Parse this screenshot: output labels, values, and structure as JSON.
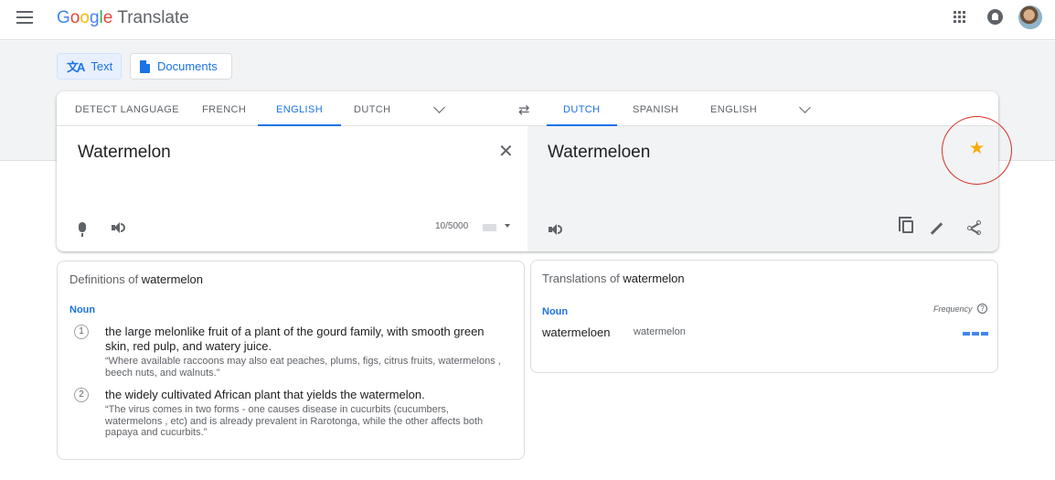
{
  "header": {
    "logo_letters": [
      "G",
      "o",
      "o",
      "g",
      "l",
      "e"
    ],
    "product": "Translate"
  },
  "modes": {
    "text": "Text",
    "documents": "Documents"
  },
  "source_langs": [
    "DETECT LANGUAGE",
    "FRENCH",
    "ENGLISH",
    "DUTCH"
  ],
  "target_langs": [
    "DUTCH",
    "SPANISH",
    "ENGLISH"
  ],
  "source": {
    "text": "Watermelon",
    "char_count": "10/5000"
  },
  "target": {
    "text": "Watermeloen"
  },
  "definitions": {
    "title_prefix": "Definitions of",
    "word": "watermelon",
    "pos": "Noun",
    "items": [
      {
        "num": "1",
        "text": "the large melonlike fruit of a plant of the gourd family, with smooth green skin, red pulp, and watery juice.",
        "example": "“Where available raccoons may also eat peaches, plums, figs, citrus fruits, watermelons , beech nuts, and walnuts.”"
      },
      {
        "num": "2",
        "text": "the widely cultivated African plant that yields the watermelon.",
        "example": "“The virus comes in two forms - one causes disease in cucurbits (cucumbers, watermelons , etc) and is already prevalent in Rarotonga, while the other affects both papaya and cucurbits.”"
      }
    ]
  },
  "translations": {
    "title_prefix": "Translations of",
    "word": "watermelon",
    "pos": "Noun",
    "frequency_label": "Frequency",
    "help_glyph": "?",
    "rows": [
      {
        "word": "watermeloen",
        "back": "watermelon",
        "frequency": 1.0
      }
    ]
  },
  "colors": {
    "accent": "#1a73e8",
    "star": "#f9ab00",
    "highlight": "#d93025"
  }
}
